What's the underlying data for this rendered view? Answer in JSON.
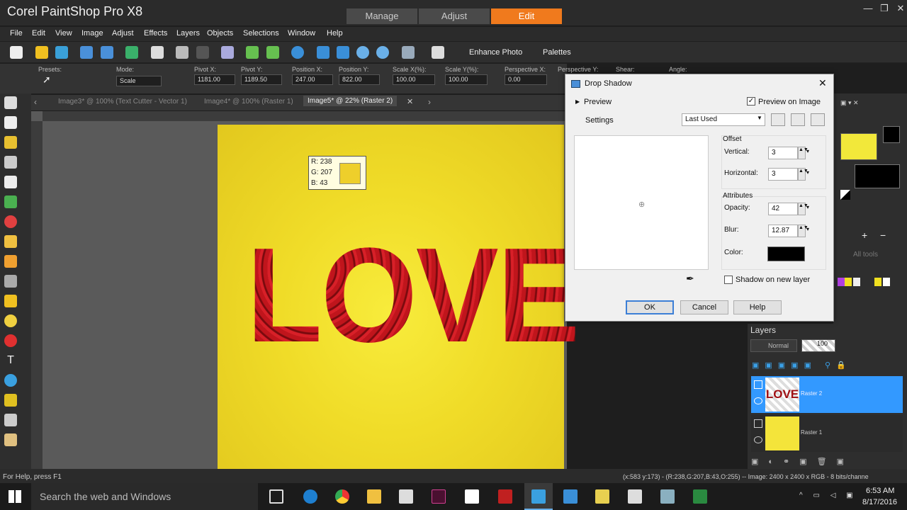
{
  "app": {
    "title": "Corel PaintShop Pro X8",
    "workspace_tabs": [
      "Manage",
      "Adjust",
      "Edit"
    ],
    "active_workspace": "Edit"
  },
  "menu": [
    "File",
    "Edit",
    "View",
    "Image",
    "Adjust",
    "Effects",
    "Layers",
    "Objects",
    "Selections",
    "Window",
    "Help"
  ],
  "toolbar": {
    "enhance_photo": "Enhance Photo",
    "palettes": "Palettes"
  },
  "tool_options": {
    "presets_label": "Presets:",
    "mode_label": "Mode:",
    "mode_value": "Scale",
    "pivot_x_label": "Pivot X:",
    "pivot_x": "1181.00",
    "pivot_y_label": "Pivot Y:",
    "pivot_y": "1189.50",
    "position_x_label": "Position X:",
    "position_x": "247.00",
    "position_y_label": "Position Y:",
    "position_y": "822.00",
    "scale_x_label": "Scale X(%):",
    "scale_x": "100.00",
    "scale_y_label": "Scale Y(%):",
    "scale_y": "100.00",
    "perspective_x_label": "Perspective X:",
    "perspective_x": "0.00",
    "perspective_y_label": "Perspective Y:",
    "shear_label": "Shear:",
    "angle_label": "Angle:"
  },
  "doc_tabs": [
    "Image3* @ 100% (Text Cutter - Vector 1)",
    "Image4* @ 100% (Raster 1)",
    "Image5* @  22% (Raster 2)"
  ],
  "canvas": {
    "text": "LOVE",
    "readout": {
      "r": "R: 238",
      "g": "G: 207",
      "b": "B: 43",
      "swatch": "#eecf2b"
    }
  },
  "dialog": {
    "title": "Drop Shadow",
    "preview_label": "Preview",
    "preview_on_image": "Preview on Image",
    "settings_label": "Settings",
    "settings_value": "Last Used",
    "offset_label": "Offset",
    "vertical_label": "Vertical:",
    "vertical_value": "3",
    "horizontal_label": "Horizontal:",
    "horizontal_value": "3",
    "attributes_label": "Attributes",
    "opacity_label": "Opacity:",
    "opacity_value": "42",
    "blur_label": "Blur:",
    "blur_value": "12.87",
    "color_label": "Color:",
    "color_value": "#000000",
    "shadow_new_layer": "Shadow on new layer",
    "ok": "OK",
    "cancel": "Cancel",
    "help": "Help"
  },
  "right_panel": {
    "all_tools": "All tools"
  },
  "layers": {
    "title": "Layers",
    "blend_mode": "Normal",
    "opacity": "100",
    "items": [
      {
        "name": "Raster 2",
        "thumb_text": "LOVE"
      },
      {
        "name": "Raster 1"
      }
    ]
  },
  "status": {
    "help": "For Help, press F1",
    "info": "(x:583 y:173) - (R:238,G:207,B:43,O:255) -- Image:  2400 x 2400 x RGB - 8 bits/channe"
  },
  "taskbar": {
    "search": "Search the web and Windows",
    "time": "6:53 AM",
    "date": "8/17/2016"
  },
  "colors": {
    "accent": "#f07a1d",
    "selection": "#3399ff"
  }
}
